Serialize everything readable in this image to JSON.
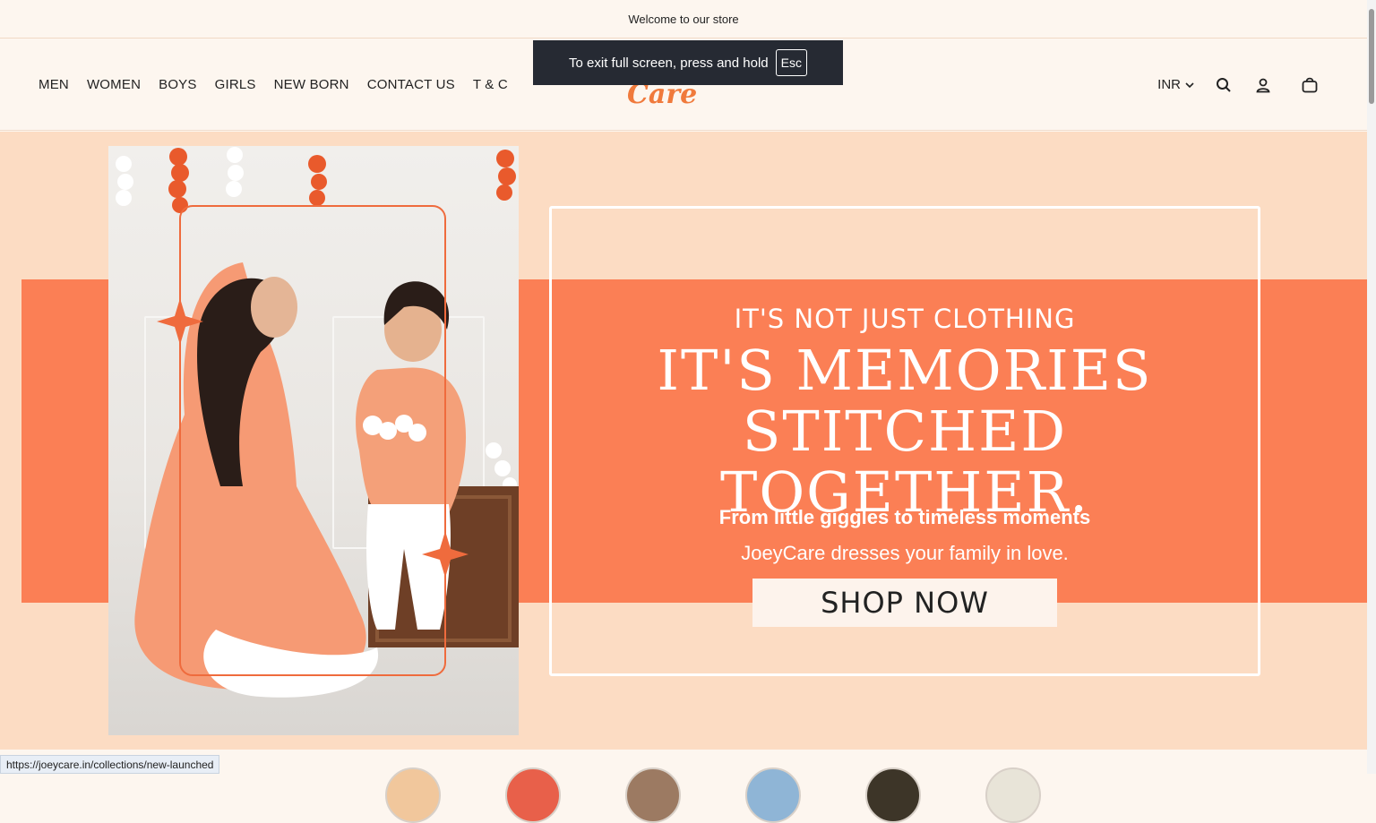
{
  "announcement": "Welcome to our store",
  "nav": [
    "MEN",
    "WOMEN",
    "BOYS",
    "GIRLS",
    "NEW BORN",
    "CONTACT US",
    "T & C"
  ],
  "logo_text": "Joey Care",
  "fullscreen_toast": {
    "message": "To exit full screen, press and hold",
    "key": "Esc"
  },
  "header_right": {
    "currency": "INR"
  },
  "hero": {
    "eyebrow": "IT'S NOT JUST CLOTHING",
    "headline_line1": "IT'S MEMORIES",
    "headline_line2": "STITCHED TOGETHER.",
    "subhead": "From little giggles to timeless moments",
    "tagline": "JoeyCare dresses your family in love.",
    "cta": "SHOP NOW"
  },
  "status_url": "https://joeycare.in/collections/new-launched",
  "colors": {
    "accent": "#fb7f55",
    "peach": "#fcdcc3",
    "cream": "#fdf6ef"
  }
}
